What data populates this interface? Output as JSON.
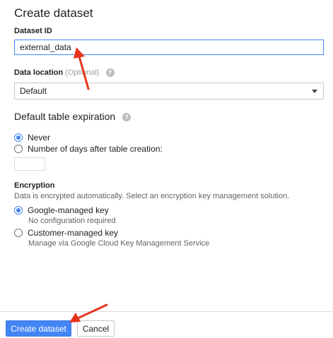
{
  "dialog": {
    "title": "Create dataset"
  },
  "dataset_id": {
    "label": "Dataset ID",
    "value": "external_data"
  },
  "data_location": {
    "label": "Data location",
    "optional_label": "(Optional)",
    "selected": "Default"
  },
  "expiration": {
    "heading": "Default table expiration",
    "options": [
      {
        "label": "Never",
        "checked": true
      },
      {
        "label": "Number of days after table creation:",
        "checked": false
      }
    ]
  },
  "encryption": {
    "heading": "Encryption",
    "description": "Data is encrypted automatically. Select an encryption key management solution.",
    "options": [
      {
        "label": "Google-managed key",
        "sublabel": "No configuration required",
        "checked": true
      },
      {
        "label": "Customer-managed key",
        "sublabel": "Manage via Google Cloud Key Management Service",
        "checked": false
      }
    ]
  },
  "actions": {
    "create_label": "Create dataset",
    "cancel_label": "Cancel"
  },
  "icons": {
    "help": "help-icon",
    "dropdown": "chevron-down-icon",
    "arrow": "annotation-arrow"
  },
  "colors": {
    "accent": "#4285f4",
    "annotation": "#e8341c"
  }
}
